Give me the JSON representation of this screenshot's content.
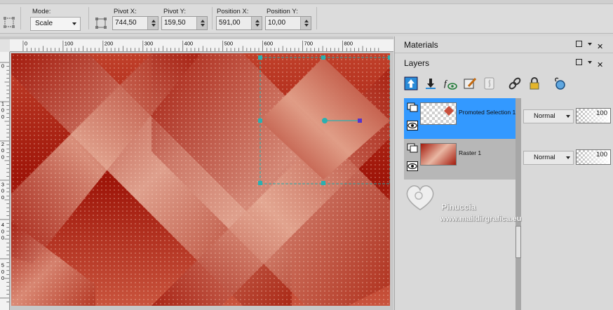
{
  "toolbar": {
    "mode_label": "Mode:",
    "mode_value": "Scale",
    "pivot_x_label": "Pivot X:",
    "pivot_x_value": "744,50",
    "pivot_y_label": "Pivot Y:",
    "pivot_y_value": "159,50",
    "position_x_label": "Position X:",
    "position_x_value": "591,00",
    "position_y_label": "Position Y:",
    "position_y_value": "10,00"
  },
  "ruler": {
    "horizontal": [
      "0",
      "100",
      "200",
      "300",
      "400",
      "500",
      "600",
      "700",
      "800"
    ],
    "vertical": [
      "0",
      "1",
      "0",
      "0",
      "2",
      "0",
      "0",
      "3",
      "0",
      "0",
      "4",
      "0",
      "0",
      "5",
      "0",
      "0"
    ]
  },
  "materials": {
    "title": "Materials"
  },
  "layers": {
    "title": "Layers",
    "items": [
      {
        "name": "Promoted Selection 1",
        "blend": "Normal",
        "opacity": "100"
      },
      {
        "name": "Raster 1",
        "blend": "Normal",
        "opacity": "100"
      }
    ]
  },
  "watermark": {
    "name": "Pinuccia",
    "url": "www.maildirgrafica.eu"
  },
  "colors": {
    "selected": "#3399ff",
    "canvas_dark": "#9e1408",
    "canvas_light": "#e9b7a3",
    "marquee": "#2ab0b0"
  },
  "icons": [
    "deform-icon",
    "bounding-icon",
    "new-raster-layer-icon",
    "new-vector-layer-icon",
    "new-art-media-icon",
    "new-adjustment-layer-icon",
    "new-mask-layer-icon",
    "link-icon",
    "lock-icon",
    "lasso-icon",
    "layer-type-icon",
    "visibility-eye-icon"
  ]
}
